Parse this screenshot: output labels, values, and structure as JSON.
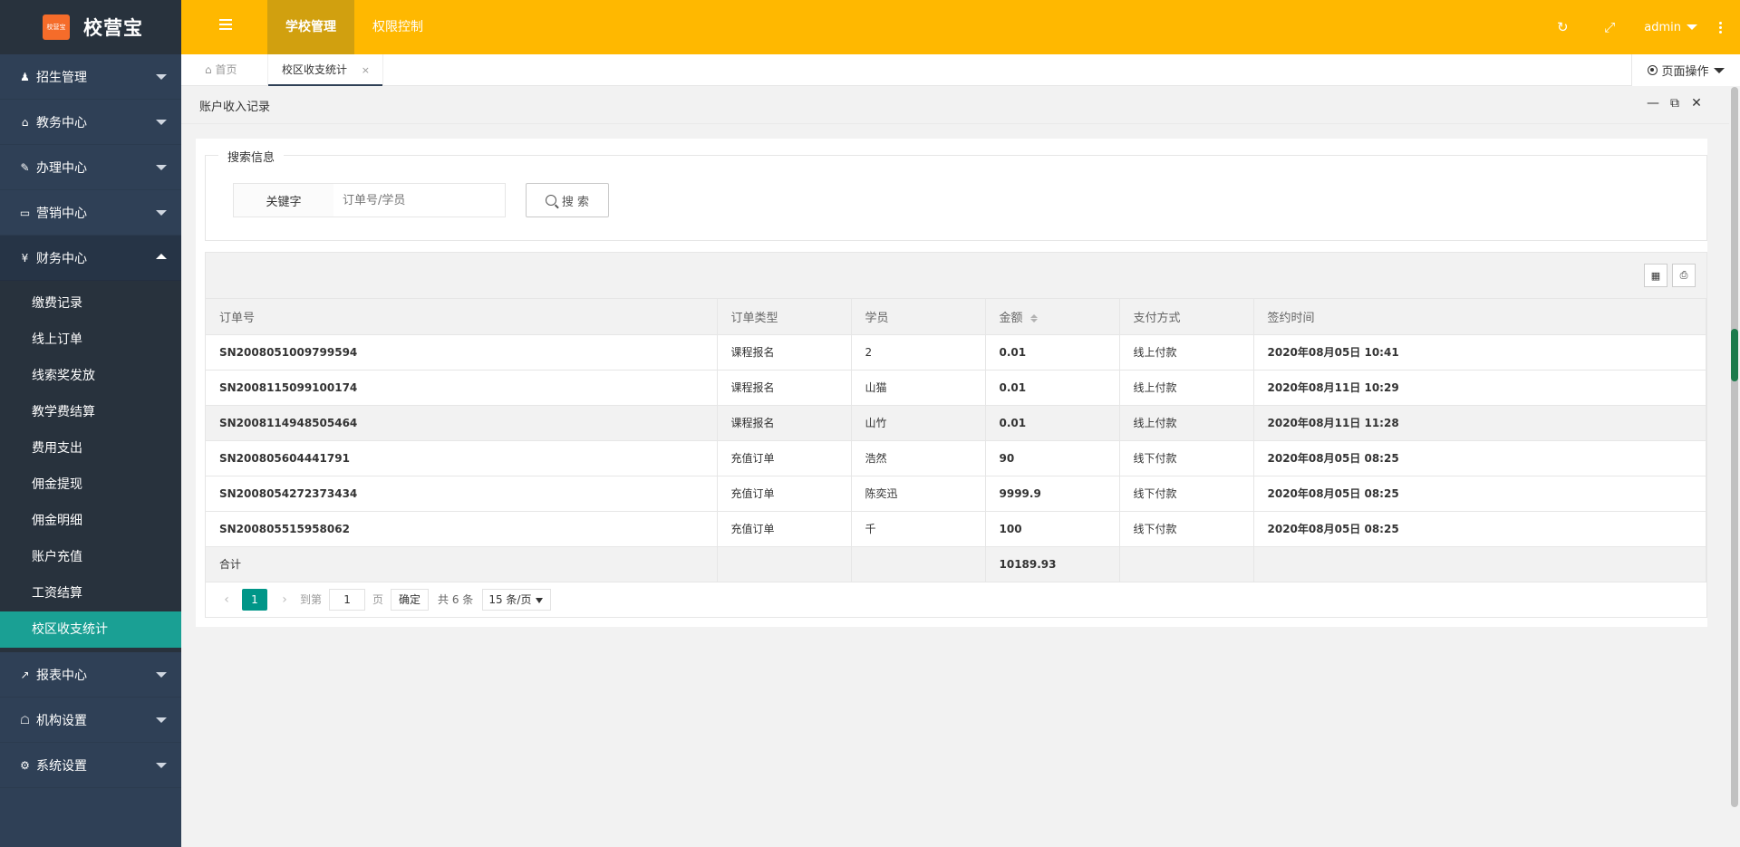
{
  "brand": {
    "badge": "校营宝",
    "name": "校营宝",
    "color": "#f56c2a"
  },
  "header": {
    "menu_icon": "hamburger-icon",
    "menus": [
      {
        "label": "学校管理",
        "active": true
      },
      {
        "label": "权限控制",
        "active": false
      }
    ],
    "refresh_icon": "refresh-icon",
    "fullscreen_icon": "fullscreen-icon",
    "user": "admin",
    "more_icon": "kebab-icon",
    "color": "#ffb800"
  },
  "sidebar": {
    "groups": [
      {
        "label": "招生管理",
        "icon": "user-icon"
      },
      {
        "label": "教务中心",
        "icon": "graduation-cap-icon"
      },
      {
        "label": "办理中心",
        "icon": "edit-icon"
      },
      {
        "label": "营销中心",
        "icon": "laptop-icon"
      },
      {
        "label": "财务中心",
        "icon": "yen-icon"
      },
      {
        "label": "报表中心",
        "icon": "line-chart-icon"
      },
      {
        "label": "机构设置",
        "icon": "bank-icon"
      },
      {
        "label": "系统设置",
        "icon": "cogs-icon"
      }
    ],
    "finance_items": [
      "缴费记录",
      "线上订单",
      "线索奖发放",
      "教学费结算",
      "费用支出",
      "佣金提现",
      "佣金明细",
      "账户充值",
      "工资结算",
      "校区收支统计"
    ],
    "active_item": "校区收支统计"
  },
  "tabs": {
    "home": "首页",
    "current": "校区收支统计",
    "close": "×",
    "page_ops": "页面操作"
  },
  "page": {
    "title": "账户收入记录",
    "search": {
      "legend": "搜索信息",
      "keyword_label": "关键字",
      "keyword_placeholder": "订单号/学员",
      "keyword_value": "",
      "button": "搜 索"
    },
    "table": {
      "columns": [
        "订单号",
        "订单类型",
        "学员",
        "金额",
        "支付方式",
        "签约时间"
      ],
      "rows": [
        [
          "SN2008051009799594",
          "课程报名",
          "2",
          "0.01",
          "线上付款",
          "2020年08月05日 10:41"
        ],
        [
          "SN2008115099100174",
          "课程报名",
          "山猫",
          "0.01",
          "线上付款",
          "2020年08月11日 10:29"
        ],
        [
          "SN2008114948505464",
          "课程报名",
          "山竹",
          "0.01",
          "线上付款",
          "2020年08月11日 11:28"
        ],
        [
          "SN200805604441791",
          "充值订单",
          "浩然",
          "90",
          "线下付款",
          "2020年08月05日 08:25"
        ],
        [
          "SN2008054272373434",
          "充值订单",
          "陈奕迅",
          "9999.9",
          "线下付款",
          "2020年08月05日 08:25"
        ],
        [
          "SN200805515958062",
          "充值订单",
          "千",
          "100",
          "线下付款",
          "2020年08月05日 08:25"
        ]
      ],
      "total_label": "合计",
      "total_amount": "10189.93"
    },
    "pager": {
      "current": "1",
      "goto_label": "到第",
      "goto_value": "1",
      "page_unit": "页",
      "confirm": "确定",
      "total": "共 6 条",
      "page_size": "15 条/页"
    }
  }
}
